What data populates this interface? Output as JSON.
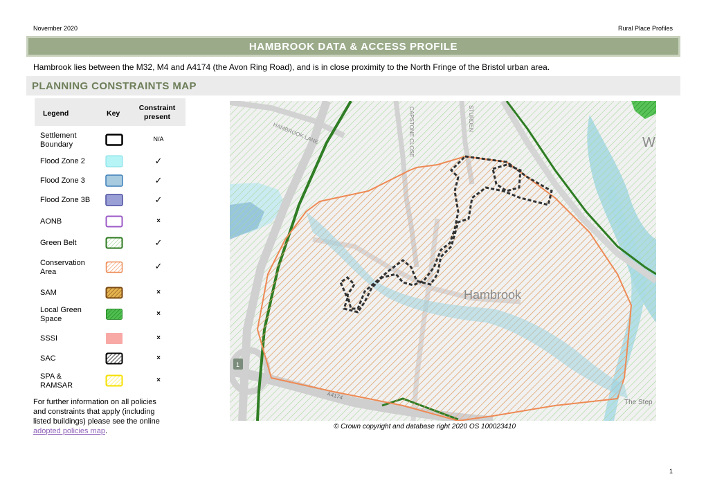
{
  "header": {
    "date": "November 2020",
    "profile": "Rural Place Profiles",
    "title": "HAMBROOK DATA & ACCESS PROFILE"
  },
  "intro_text": "Hambrook lies between the M32, M4 and A4174 (the Avon Ring Road), and is in close proximity to the North Fringe of the Bristol urban area.",
  "section_title": "PLANNING CONSTRAINTS MAP",
  "legend": {
    "header_legend": "Legend",
    "header_key": "Key",
    "header_constraint_line1": "Constraint",
    "header_constraint_line2": "present",
    "rows": [
      {
        "label_line1": "Settlement",
        "label_line2": "Boundary",
        "present": "N/A",
        "key": "settlement-boundary"
      },
      {
        "label_line1": "Flood Zone 2",
        "label_line2": "",
        "present": "✓",
        "key": "flood-zone-2"
      },
      {
        "label_line1": "Flood Zone 3",
        "label_line2": "",
        "present": "✓",
        "key": "flood-zone-3"
      },
      {
        "label_line1": "Flood Zone 3B",
        "label_line2": "",
        "present": "✓",
        "key": "flood-zone-3b"
      },
      {
        "label_line1": "AONB",
        "label_line2": "",
        "present": "×",
        "key": "aonb"
      },
      {
        "label_line1": "Green Belt",
        "label_line2": "",
        "present": "✓",
        "key": "green-belt"
      },
      {
        "label_line1": "Conservation",
        "label_line2": "Area",
        "present": "✓",
        "key": "conservation-area"
      },
      {
        "label_line1": "SAM",
        "label_line2": "",
        "present": "×",
        "key": "sam"
      },
      {
        "label_line1": "Local Green",
        "label_line2": "Space",
        "present": "×",
        "key": "local-green-space"
      },
      {
        "label_line1": "SSSI",
        "label_line2": "",
        "present": "×",
        "key": "sssi"
      },
      {
        "label_line1": "SAC",
        "label_line2": "",
        "present": "×",
        "key": "sac"
      },
      {
        "label_line1": "SPA &",
        "label_line2": "RAMSAR",
        "present": "×",
        "key": "spa-ramsar"
      }
    ]
  },
  "footer_note": {
    "line1": "For further information on all policies",
    "line2": "and constraints that apply (including",
    "line3": "listed buildings) please see the online",
    "link_text": "adopted policies map",
    "suffix": "."
  },
  "map": {
    "labels": {
      "hambrook_lane": "HAMBROOK LANE",
      "capstone_close": "CAPSTONE CLOSE",
      "sturden": "STURDEN",
      "village": "Hambrook",
      "road_a4174": "A4174",
      "the_step": "The Step",
      "w": "W",
      "junction": "1"
    }
  },
  "copyright": "© Crown copyright and database right 2020 OS 100023410",
  "page_number": "1",
  "colors": {
    "title_bar": "#9bab8a",
    "section_text": "#6d7e59",
    "green_belt": "#3c8a2e",
    "conservation": "#ee8a55",
    "settlement": "#3a3a3a",
    "flood": "#8cc4d6"
  }
}
